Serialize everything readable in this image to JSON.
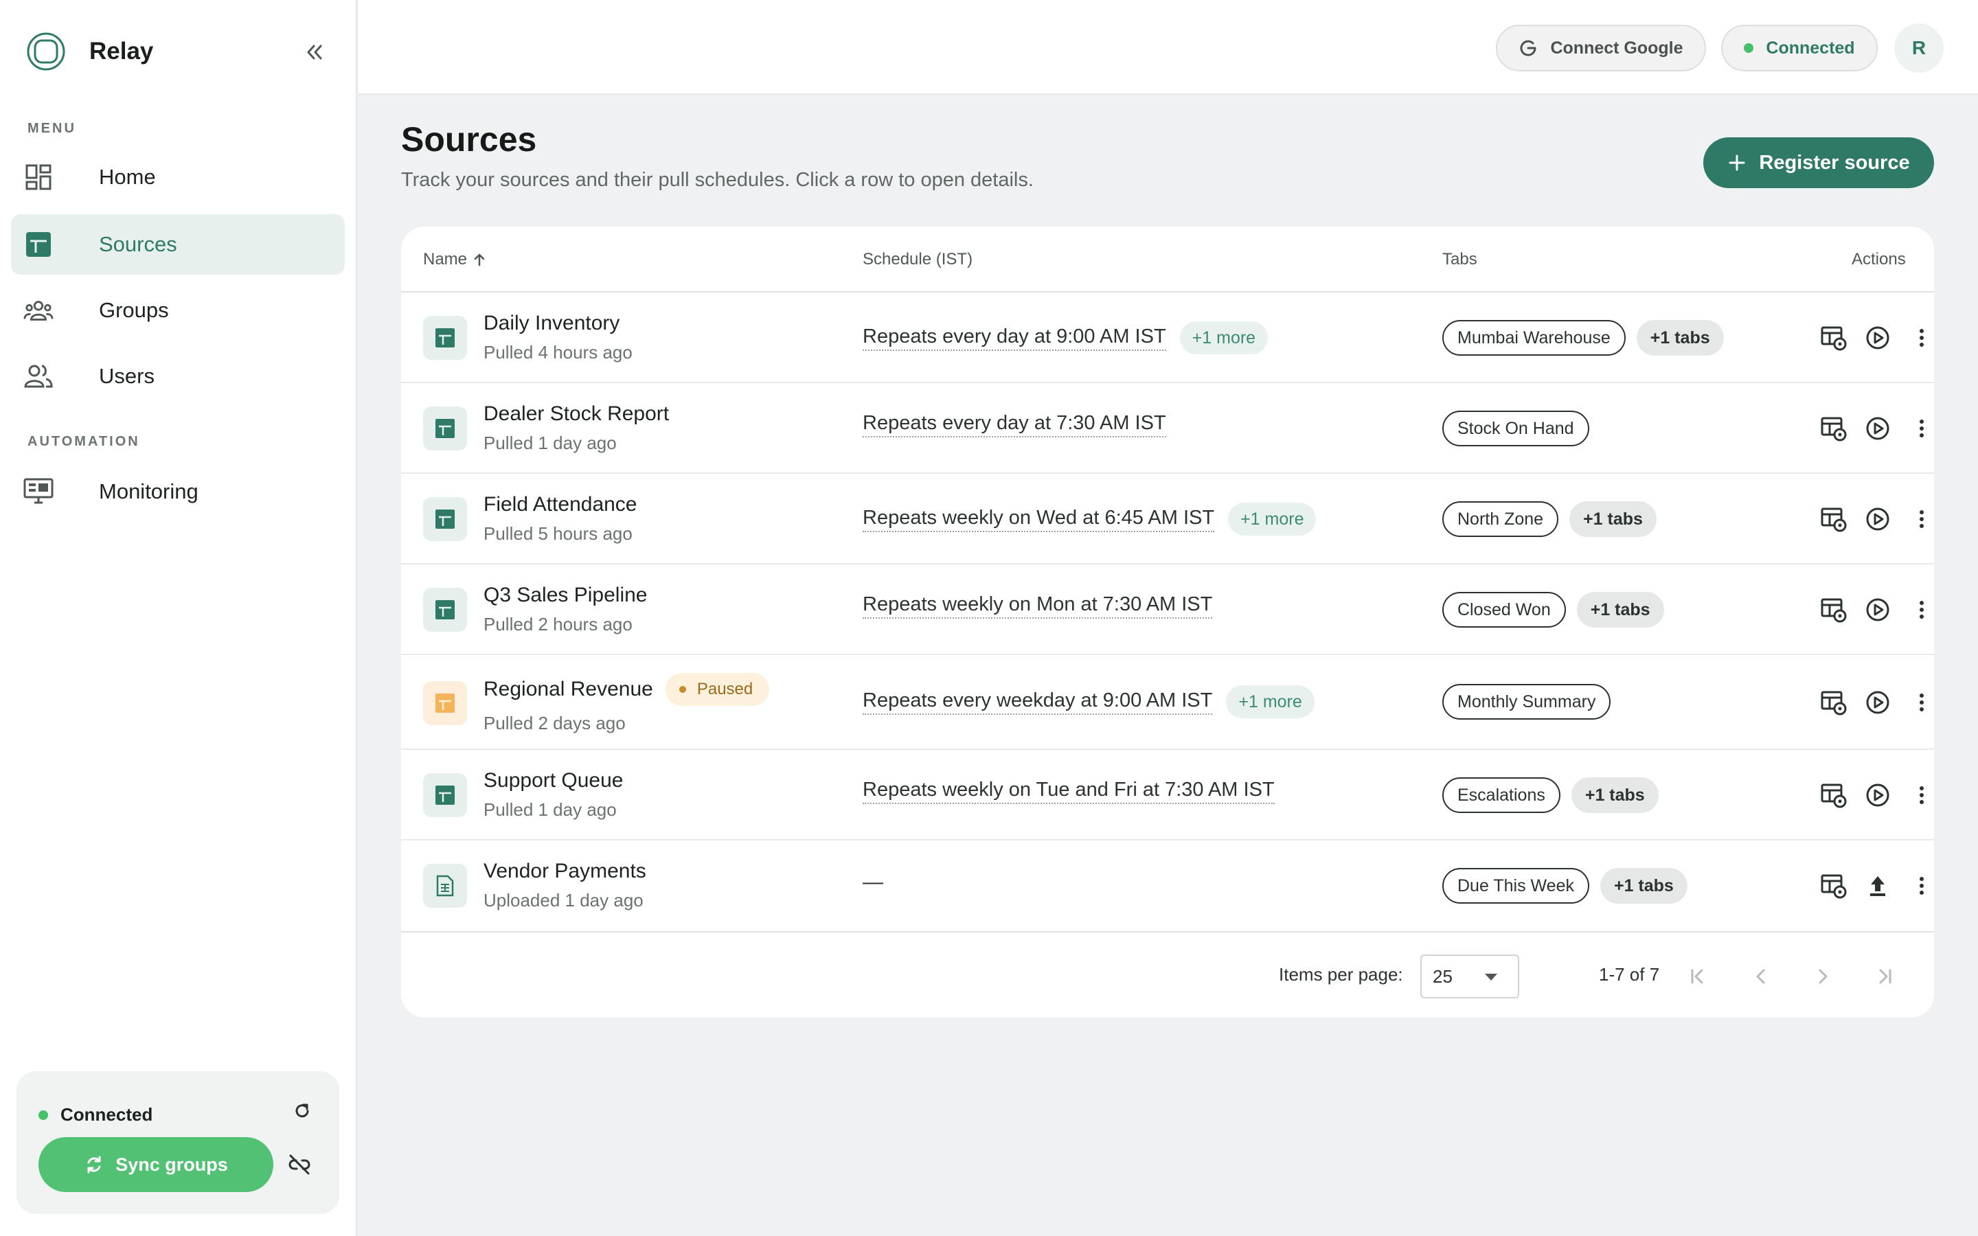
{
  "app": {
    "name": "Relay"
  },
  "sidebar": {
    "menu_label": "MENU",
    "automation_label": "AUTOMATION",
    "items": [
      {
        "label": "Home",
        "icon": "dashboard-icon"
      },
      {
        "label": "Sources",
        "icon": "spreadsheet-icon",
        "active": true
      },
      {
        "label": "Groups",
        "icon": "groups-icon"
      },
      {
        "label": "Users",
        "icon": "users-icon"
      },
      {
        "label": "Monitoring",
        "icon": "monitor-icon"
      }
    ],
    "status": {
      "text": "Connected",
      "sync_label": "Sync groups"
    }
  },
  "header": {
    "connect_google": "Connect Google",
    "connected": "Connected",
    "avatar_initial": "R"
  },
  "page": {
    "title": "Sources",
    "subtitle": "Track your sources and their pull schedules. Click a row to open details.",
    "register_label": "Register source"
  },
  "table": {
    "columns": {
      "name": "Name",
      "schedule": "Schedule (IST)",
      "tabs": "Tabs",
      "actions": "Actions"
    },
    "rows": [
      {
        "name": "Daily Inventory",
        "sub": "Pulled 4 hours ago",
        "schedule": "Repeats every day at 9:00 AM IST",
        "more": "+1 more",
        "tab": "Mumbai Warehouse",
        "tabs_more": "+1 tabs"
      },
      {
        "name": "Dealer Stock Report",
        "sub": "Pulled 1 day ago",
        "schedule": "Repeats every day at 7:30 AM IST",
        "more": "",
        "tab": "Stock On Hand",
        "tabs_more": ""
      },
      {
        "name": "Field Attendance",
        "sub": "Pulled 5 hours ago",
        "schedule": "Repeats weekly on Wed at 6:45 AM IST",
        "more": "+1 more",
        "tab": "North Zone",
        "tabs_more": "+1 tabs"
      },
      {
        "name": "Q3 Sales Pipeline",
        "sub": "Pulled 2 hours ago",
        "schedule": "Repeats weekly on Mon at 7:30 AM IST",
        "more": "",
        "tab": "Closed Won",
        "tabs_more": "+1 tabs"
      },
      {
        "name": "Regional Revenue",
        "badge": "Paused",
        "sub": "Pulled 2 days ago",
        "schedule": "Repeats every weekday at 9:00 AM IST",
        "more": "+1 more",
        "tab": "Monthly Summary",
        "tabs_more": ""
      },
      {
        "name": "Support Queue",
        "sub": "Pulled 1 day ago",
        "schedule": "Repeats weekly on Tue and Fri at 7:30 AM IST",
        "more": "",
        "tab": "Escalations",
        "tabs_more": "+1 tabs"
      },
      {
        "name": "Vendor Payments",
        "sub": "Uploaded 1 day ago",
        "schedule": "—",
        "more": "",
        "tab": "Due This Week",
        "tabs_more": "+1 tabs"
      }
    ]
  },
  "pagination": {
    "items_per_page_label": "Items per page:",
    "items_per_page": "25",
    "range": "1-7 of 7"
  },
  "colors": {
    "accent": "#2e7a67",
    "success": "#52c174",
    "paused": "#c98a2a"
  }
}
